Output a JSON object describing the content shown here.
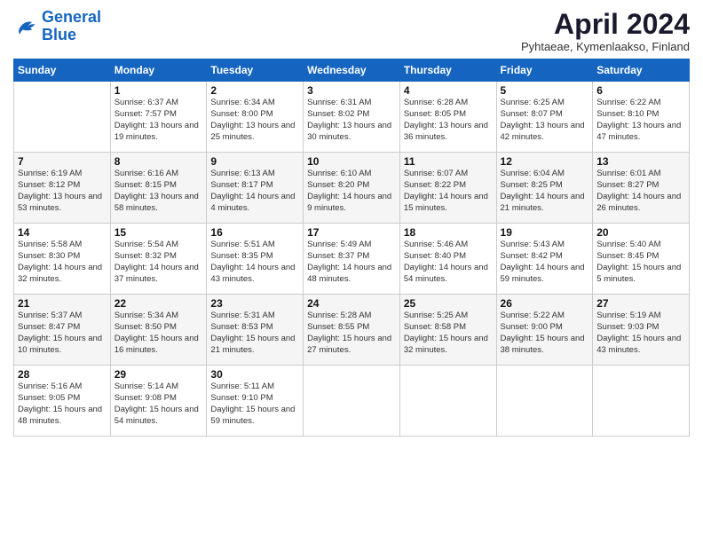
{
  "logo": {
    "line1": "General",
    "line2": "Blue"
  },
  "title": "April 2024",
  "location": "Pyhtaeae, Kymenlaakso, Finland",
  "weekdays": [
    "Sunday",
    "Monday",
    "Tuesday",
    "Wednesday",
    "Thursday",
    "Friday",
    "Saturday"
  ],
  "weeks": [
    [
      {
        "day": "",
        "sunrise": "",
        "sunset": "",
        "daylight": ""
      },
      {
        "day": "1",
        "sunrise": "Sunrise: 6:37 AM",
        "sunset": "Sunset: 7:57 PM",
        "daylight": "Daylight: 13 hours and 19 minutes."
      },
      {
        "day": "2",
        "sunrise": "Sunrise: 6:34 AM",
        "sunset": "Sunset: 8:00 PM",
        "daylight": "Daylight: 13 hours and 25 minutes."
      },
      {
        "day": "3",
        "sunrise": "Sunrise: 6:31 AM",
        "sunset": "Sunset: 8:02 PM",
        "daylight": "Daylight: 13 hours and 30 minutes."
      },
      {
        "day": "4",
        "sunrise": "Sunrise: 6:28 AM",
        "sunset": "Sunset: 8:05 PM",
        "daylight": "Daylight: 13 hours and 36 minutes."
      },
      {
        "day": "5",
        "sunrise": "Sunrise: 6:25 AM",
        "sunset": "Sunset: 8:07 PM",
        "daylight": "Daylight: 13 hours and 42 minutes."
      },
      {
        "day": "6",
        "sunrise": "Sunrise: 6:22 AM",
        "sunset": "Sunset: 8:10 PM",
        "daylight": "Daylight: 13 hours and 47 minutes."
      }
    ],
    [
      {
        "day": "7",
        "sunrise": "Sunrise: 6:19 AM",
        "sunset": "Sunset: 8:12 PM",
        "daylight": "Daylight: 13 hours and 53 minutes."
      },
      {
        "day": "8",
        "sunrise": "Sunrise: 6:16 AM",
        "sunset": "Sunset: 8:15 PM",
        "daylight": "Daylight: 13 hours and 58 minutes."
      },
      {
        "day": "9",
        "sunrise": "Sunrise: 6:13 AM",
        "sunset": "Sunset: 8:17 PM",
        "daylight": "Daylight: 14 hours and 4 minutes."
      },
      {
        "day": "10",
        "sunrise": "Sunrise: 6:10 AM",
        "sunset": "Sunset: 8:20 PM",
        "daylight": "Daylight: 14 hours and 9 minutes."
      },
      {
        "day": "11",
        "sunrise": "Sunrise: 6:07 AM",
        "sunset": "Sunset: 8:22 PM",
        "daylight": "Daylight: 14 hours and 15 minutes."
      },
      {
        "day": "12",
        "sunrise": "Sunrise: 6:04 AM",
        "sunset": "Sunset: 8:25 PM",
        "daylight": "Daylight: 14 hours and 21 minutes."
      },
      {
        "day": "13",
        "sunrise": "Sunrise: 6:01 AM",
        "sunset": "Sunset: 8:27 PM",
        "daylight": "Daylight: 14 hours and 26 minutes."
      }
    ],
    [
      {
        "day": "14",
        "sunrise": "Sunrise: 5:58 AM",
        "sunset": "Sunset: 8:30 PM",
        "daylight": "Daylight: 14 hours and 32 minutes."
      },
      {
        "day": "15",
        "sunrise": "Sunrise: 5:54 AM",
        "sunset": "Sunset: 8:32 PM",
        "daylight": "Daylight: 14 hours and 37 minutes."
      },
      {
        "day": "16",
        "sunrise": "Sunrise: 5:51 AM",
        "sunset": "Sunset: 8:35 PM",
        "daylight": "Daylight: 14 hours and 43 minutes."
      },
      {
        "day": "17",
        "sunrise": "Sunrise: 5:49 AM",
        "sunset": "Sunset: 8:37 PM",
        "daylight": "Daylight: 14 hours and 48 minutes."
      },
      {
        "day": "18",
        "sunrise": "Sunrise: 5:46 AM",
        "sunset": "Sunset: 8:40 PM",
        "daylight": "Daylight: 14 hours and 54 minutes."
      },
      {
        "day": "19",
        "sunrise": "Sunrise: 5:43 AM",
        "sunset": "Sunset: 8:42 PM",
        "daylight": "Daylight: 14 hours and 59 minutes."
      },
      {
        "day": "20",
        "sunrise": "Sunrise: 5:40 AM",
        "sunset": "Sunset: 8:45 PM",
        "daylight": "Daylight: 15 hours and 5 minutes."
      }
    ],
    [
      {
        "day": "21",
        "sunrise": "Sunrise: 5:37 AM",
        "sunset": "Sunset: 8:47 PM",
        "daylight": "Daylight: 15 hours and 10 minutes."
      },
      {
        "day": "22",
        "sunrise": "Sunrise: 5:34 AM",
        "sunset": "Sunset: 8:50 PM",
        "daylight": "Daylight: 15 hours and 16 minutes."
      },
      {
        "day": "23",
        "sunrise": "Sunrise: 5:31 AM",
        "sunset": "Sunset: 8:53 PM",
        "daylight": "Daylight: 15 hours and 21 minutes."
      },
      {
        "day": "24",
        "sunrise": "Sunrise: 5:28 AM",
        "sunset": "Sunset: 8:55 PM",
        "daylight": "Daylight: 15 hours and 27 minutes."
      },
      {
        "day": "25",
        "sunrise": "Sunrise: 5:25 AM",
        "sunset": "Sunset: 8:58 PM",
        "daylight": "Daylight: 15 hours and 32 minutes."
      },
      {
        "day": "26",
        "sunrise": "Sunrise: 5:22 AM",
        "sunset": "Sunset: 9:00 PM",
        "daylight": "Daylight: 15 hours and 38 minutes."
      },
      {
        "day": "27",
        "sunrise": "Sunrise: 5:19 AM",
        "sunset": "Sunset: 9:03 PM",
        "daylight": "Daylight: 15 hours and 43 minutes."
      }
    ],
    [
      {
        "day": "28",
        "sunrise": "Sunrise: 5:16 AM",
        "sunset": "Sunset: 9:05 PM",
        "daylight": "Daylight: 15 hours and 48 minutes."
      },
      {
        "day": "29",
        "sunrise": "Sunrise: 5:14 AM",
        "sunset": "Sunset: 9:08 PM",
        "daylight": "Daylight: 15 hours and 54 minutes."
      },
      {
        "day": "30",
        "sunrise": "Sunrise: 5:11 AM",
        "sunset": "Sunset: 9:10 PM",
        "daylight": "Daylight: 15 hours and 59 minutes."
      },
      {
        "day": "",
        "sunrise": "",
        "sunset": "",
        "daylight": ""
      },
      {
        "day": "",
        "sunrise": "",
        "sunset": "",
        "daylight": ""
      },
      {
        "day": "",
        "sunrise": "",
        "sunset": "",
        "daylight": ""
      },
      {
        "day": "",
        "sunrise": "",
        "sunset": "",
        "daylight": ""
      }
    ]
  ]
}
